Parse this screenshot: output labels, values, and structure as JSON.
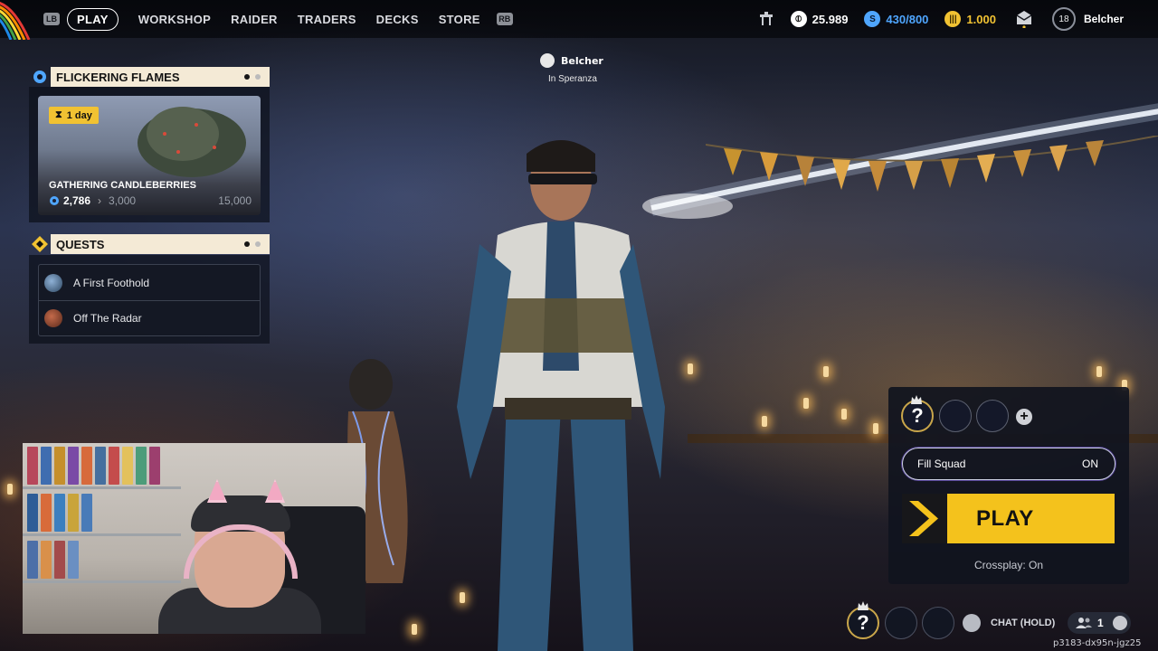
{
  "nav": {
    "left_bumper": "LB",
    "right_bumper": "RB",
    "tabs": [
      {
        "label": "PLAY",
        "active": true
      },
      {
        "label": "WORKSHOP"
      },
      {
        "label": "RAIDER"
      },
      {
        "label": "TRADERS"
      },
      {
        "label": "DECKS"
      },
      {
        "label": "STORE"
      }
    ]
  },
  "currencies": {
    "coins": "25.989",
    "blue": "430/800",
    "gold": "1.000"
  },
  "profile": {
    "level": "18",
    "username": "Belcher"
  },
  "player_tag": {
    "name": "Belcher",
    "location": "In Speranza"
  },
  "event": {
    "header": "FLICKERING FLAMES",
    "timer": "1 day",
    "title": "GATHERING CANDLEBERRIES",
    "progress_current": "2,786",
    "progress_next": "3,000",
    "progress_max": "15,000"
  },
  "quests": {
    "header": "QUESTS",
    "items": [
      {
        "label": "A First Foothold"
      },
      {
        "label": "Off The Radar"
      }
    ]
  },
  "squad": {
    "slot_self": "?",
    "fill_squad_label": "Fill Squad",
    "fill_squad_value": "ON",
    "play_label": "PLAY",
    "crossplay": "Crossplay: On"
  },
  "bottom": {
    "slot_self": "?",
    "chat_label": "CHAT (HOLD)",
    "party_count": "1",
    "build_id": "p3183-dx95n-jgz25"
  },
  "colors": {
    "accent_yellow": "#f4c21c",
    "currency_blue": "#4fa6ff",
    "currency_gold": "#f1c232",
    "header_band": "#f4ead6"
  }
}
